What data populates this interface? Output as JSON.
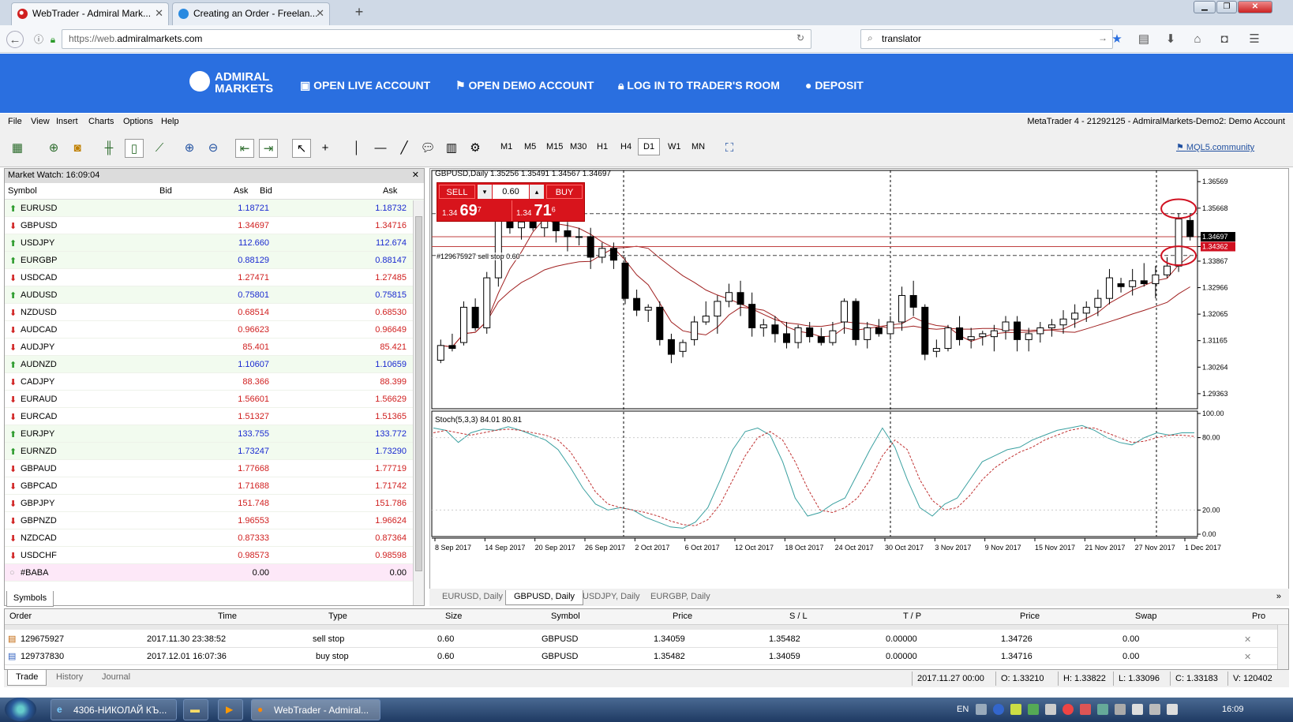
{
  "browser": {
    "tabs": [
      {
        "title": "WebTrader - Admiral Mark..."
      },
      {
        "title": "Creating an Order - Freelan..."
      }
    ],
    "url_prefix": "https://web.",
    "url_host": "admiralmarkets.com",
    "search_value": "translator"
  },
  "site": {
    "logo_line1": "ADMIRAL",
    "logo_line2": "MARKETS",
    "nav": [
      "OPEN LIVE ACCOUNT",
      "OPEN DEMO ACCOUNT",
      "LOG IN TO TRADER'S ROOM",
      "DEPOSIT"
    ]
  },
  "menu": {
    "items": [
      "File",
      "View",
      "Insert",
      "Charts",
      "Options",
      "Help"
    ],
    "account_title": "MetaTrader 4 - 21292125 - AdmiralMarkets-Demo2: Demo Account"
  },
  "toolbar": {
    "timeframes": [
      "M1",
      "M5",
      "M15",
      "M30",
      "H1",
      "H4",
      "D1",
      "W1",
      "MN"
    ],
    "active_timeframe": "D1",
    "community_link": "MQL5.community"
  },
  "market_watch": {
    "title": "Market Watch: 16:09:04",
    "columns": [
      "Symbol",
      "Bid",
      "Ask",
      "Bid",
      "Ask"
    ],
    "rows": [
      {
        "symbol": "EURUSD",
        "dir": "up",
        "bid": "1.18721",
        "ask": "1.18732"
      },
      {
        "symbol": "GBPUSD",
        "dir": "down",
        "bid": "1.34697",
        "ask": "1.34716"
      },
      {
        "symbol": "USDJPY",
        "dir": "up",
        "bid": "112.660",
        "ask": "112.674"
      },
      {
        "symbol": "EURGBP",
        "dir": "up",
        "bid": "0.88129",
        "ask": "0.88147"
      },
      {
        "symbol": "USDCAD",
        "dir": "down",
        "bid": "1.27471",
        "ask": "1.27485"
      },
      {
        "symbol": "AUDUSD",
        "dir": "up",
        "bid": "0.75801",
        "ask": "0.75815"
      },
      {
        "symbol": "NZDUSD",
        "dir": "down",
        "bid": "0.68514",
        "ask": "0.68530"
      },
      {
        "symbol": "AUDCAD",
        "dir": "down",
        "bid": "0.96623",
        "ask": "0.96649"
      },
      {
        "symbol": "AUDJPY",
        "dir": "down",
        "bid": "85.401",
        "ask": "85.421"
      },
      {
        "symbol": "AUDNZD",
        "dir": "up",
        "bid": "1.10607",
        "ask": "1.10659"
      },
      {
        "symbol": "CADJPY",
        "dir": "down",
        "bid": "88.366",
        "ask": "88.399"
      },
      {
        "symbol": "EURAUD",
        "dir": "down",
        "bid": "1.56601",
        "ask": "1.56629"
      },
      {
        "symbol": "EURCAD",
        "dir": "down",
        "bid": "1.51327",
        "ask": "1.51365"
      },
      {
        "symbol": "EURJPY",
        "dir": "up",
        "bid": "133.755",
        "ask": "133.772"
      },
      {
        "symbol": "EURNZD",
        "dir": "up",
        "bid": "1.73247",
        "ask": "1.73290"
      },
      {
        "symbol": "GBPAUD",
        "dir": "down",
        "bid": "1.77668",
        "ask": "1.77719"
      },
      {
        "symbol": "GBPCAD",
        "dir": "down",
        "bid": "1.71688",
        "ask": "1.71742"
      },
      {
        "symbol": "GBPJPY",
        "dir": "down",
        "bid": "151.748",
        "ask": "151.786"
      },
      {
        "symbol": "GBPNZD",
        "dir": "down",
        "bid": "1.96553",
        "ask": "1.96624"
      },
      {
        "symbol": "NZDCAD",
        "dir": "down",
        "bid": "0.87333",
        "ask": "0.87364"
      },
      {
        "symbol": "USDCHF",
        "dir": "down",
        "bid": "0.98573",
        "ask": "0.98598"
      },
      {
        "symbol": "#BABA",
        "dir": "none",
        "bid": "0.00",
        "ask": "0.00"
      }
    ],
    "tab": "Symbols"
  },
  "chart": {
    "header": "GBPUSD,Daily  1.35256 1.35491 1.34567 1.34697",
    "sell_label": "SELL",
    "buy_label": "BUY",
    "lot": "0.60",
    "sell_price_prefix": "1.34",
    "sell_price_big": "69",
    "sell_price_sup": "7",
    "buy_price_prefix": "1.34",
    "buy_price_big": "71",
    "buy_price_sup": "6",
    "order_label": "#129675927 sell stop 0.60",
    "indicator_label": "Stoch(5,3,3) 84.01 80.81",
    "price_scale": [
      "1.36569",
      "1.35668",
      "1.34697",
      "1.34362",
      "1.33867",
      "1.32966",
      "1.32065",
      "1.31165",
      "1.30264",
      "1.29363"
    ],
    "stoch_scale": [
      "100.00",
      "80.00",
      "20.00",
      "0.00"
    ],
    "dates": [
      "8 Sep 2017",
      "14 Sep 2017",
      "20 Sep 2017",
      "26 Sep 2017",
      "2 Oct 2017",
      "6 Oct 2017",
      "12 Oct 2017",
      "18 Oct 2017",
      "24 Oct 2017",
      "30 Oct 2017",
      "3 Nov 2017",
      "9 Nov 2017",
      "15 Nov 2017",
      "21 Nov 2017",
      "27 Nov 2017",
      "1 Dec 2017"
    ],
    "tabs": [
      "EURUSD, Daily",
      "GBPUSD, Daily",
      "USDJPY, Daily",
      "EURGBP, Daily"
    ],
    "active_tab": "GBPUSD, Daily",
    "colors": {
      "bid_line": "#000000",
      "ask_line": "#d00000",
      "ma": "#a02020",
      "stoch_main": "#3aa0a0",
      "stoch_signal": "#c03030",
      "circle": "#d01020"
    }
  },
  "chart_data": {
    "type": "candlestick",
    "symbol": "GBPUSD",
    "timeframe": "Daily",
    "ylim": [
      1.2885,
      1.3695
    ],
    "candles": [
      [
        1.305,
        1.312,
        1.304,
        1.31
      ],
      [
        1.31,
        1.314,
        1.308,
        1.309
      ],
      [
        1.311,
        1.325,
        1.31,
        1.323
      ],
      [
        1.323,
        1.326,
        1.315,
        1.316
      ],
      [
        1.316,
        1.335,
        1.314,
        1.333
      ],
      [
        1.333,
        1.362,
        1.33,
        1.358
      ],
      [
        1.358,
        1.365,
        1.348,
        1.35
      ],
      [
        1.35,
        1.356,
        1.346,
        1.352
      ],
      [
        1.352,
        1.36,
        1.349,
        1.35
      ],
      [
        1.35,
        1.358,
        1.347,
        1.356
      ],
      [
        1.356,
        1.36,
        1.345,
        1.349
      ],
      [
        1.349,
        1.352,
        1.342,
        1.347
      ],
      [
        1.347,
        1.35,
        1.344,
        1.347
      ],
      [
        1.347,
        1.35,
        1.336,
        1.34
      ],
      [
        1.34,
        1.345,
        1.338,
        1.343
      ],
      [
        1.343,
        1.345,
        1.336,
        1.339
      ],
      [
        1.338,
        1.34,
        1.324,
        1.326
      ],
      [
        1.326,
        1.329,
        1.32,
        1.322
      ],
      [
        1.322,
        1.324,
        1.318,
        1.323
      ],
      [
        1.323,
        1.325,
        1.31,
        1.312
      ],
      [
        1.312,
        1.314,
        1.304,
        1.307
      ],
      [
        1.308,
        1.312,
        1.306,
        1.311
      ],
      [
        1.312,
        1.32,
        1.31,
        1.318
      ],
      [
        1.318,
        1.325,
        1.317,
        1.32
      ],
      [
        1.32,
        1.327,
        1.314,
        1.325
      ],
      [
        1.325,
        1.331,
        1.323,
        1.328
      ],
      [
        1.328,
        1.332,
        1.32,
        1.324
      ],
      [
        1.324,
        1.328,
        1.313,
        1.316
      ],
      [
        1.316,
        1.319,
        1.313,
        1.317
      ],
      [
        1.317,
        1.32,
        1.311,
        1.314
      ],
      [
        1.314,
        1.318,
        1.309,
        1.311
      ],
      [
        1.311,
        1.317,
        1.309,
        1.316
      ],
      [
        1.316,
        1.318,
        1.311,
        1.313
      ],
      [
        1.313,
        1.316,
        1.31,
        1.311
      ],
      [
        1.311,
        1.318,
        1.31,
        1.315
      ],
      [
        1.318,
        1.326,
        1.314,
        1.325
      ],
      [
        1.325,
        1.326,
        1.31,
        1.312
      ],
      [
        1.312,
        1.318,
        1.309,
        1.316
      ],
      [
        1.316,
        1.319,
        1.313,
        1.314
      ],
      [
        1.314,
        1.32,
        1.312,
        1.318
      ],
      [
        1.318,
        1.33,
        1.315,
        1.327
      ],
      [
        1.327,
        1.332,
        1.32,
        1.323
      ],
      [
        1.323,
        1.324,
        1.305,
        1.307
      ],
      [
        1.308,
        1.312,
        1.306,
        1.309
      ],
      [
        1.309,
        1.317,
        1.308,
        1.316
      ],
      [
        1.316,
        1.32,
        1.31,
        1.312
      ],
      [
        1.312,
        1.316,
        1.309,
        1.313
      ],
      [
        1.313,
        1.315,
        1.31,
        1.314
      ],
      [
        1.313,
        1.317,
        1.308,
        1.315
      ],
      [
        1.315,
        1.32,
        1.312,
        1.318
      ],
      [
        1.318,
        1.32,
        1.308,
        1.312
      ],
      [
        1.312,
        1.316,
        1.308,
        1.314
      ],
      [
        1.314,
        1.318,
        1.311,
        1.316
      ],
      [
        1.316,
        1.319,
        1.313,
        1.317
      ],
      [
        1.317,
        1.322,
        1.314,
        1.319
      ],
      [
        1.319,
        1.324,
        1.316,
        1.321
      ],
      [
        1.321,
        1.325,
        1.318,
        1.323
      ],
      [
        1.323,
        1.329,
        1.32,
        1.326
      ],
      [
        1.326,
        1.336,
        1.324,
        1.333
      ],
      [
        1.331,
        1.333,
        1.328,
        1.33
      ],
      [
        1.33,
        1.336,
        1.327,
        1.332
      ],
      [
        1.332,
        1.338,
        1.33,
        1.331
      ],
      [
        1.331,
        1.337,
        1.326,
        1.334
      ],
      [
        1.334,
        1.34,
        1.333,
        1.337
      ],
      [
        1.337,
        1.355,
        1.335,
        1.353
      ],
      [
        1.3525,
        1.3549,
        1.3457,
        1.347
      ]
    ],
    "stoch_main": [
      88,
      86,
      76,
      84,
      87,
      86,
      89,
      86,
      82,
      78,
      70,
      55,
      38,
      25,
      20,
      22,
      20,
      14,
      10,
      6,
      5,
      10,
      22,
      45,
      70,
      85,
      88,
      82,
      60,
      30,
      15,
      18,
      25,
      30,
      50,
      70,
      88,
      72,
      45,
      22,
      15,
      25,
      30,
      45,
      60,
      65,
      70,
      72,
      78,
      82,
      86,
      88,
      90,
      86,
      80,
      76,
      74,
      80,
      84,
      82,
      84,
      84
    ],
    "stoch_signal": [
      84,
      86,
      84,
      82,
      84,
      86,
      87,
      86,
      84,
      82,
      78,
      68,
      52,
      35,
      25,
      22,
      20,
      18,
      15,
      11,
      8,
      7,
      12,
      25,
      45,
      65,
      80,
      85,
      78,
      60,
      38,
      20,
      18,
      22,
      30,
      45,
      65,
      78,
      70,
      45,
      28,
      20,
      22,
      32,
      45,
      55,
      62,
      68,
      72,
      78,
      82,
      86,
      88,
      88,
      84,
      80,
      76,
      77,
      80,
      82,
      82,
      81
    ]
  },
  "orders": {
    "columns": [
      "Order",
      "Time",
      "Type",
      "Size",
      "Symbol",
      "Price",
      "S / L",
      "T / P",
      "Price",
      "Swap",
      "Pro"
    ],
    "rows": [
      [
        "129675927",
        "2017.11.30 23:38:52",
        "sell stop",
        "0.60",
        "GBPUSD",
        "1.34059",
        "1.35482",
        "0.00000",
        "1.34726",
        "0.00"
      ],
      [
        "129737830",
        "2017.12.01 16:07:36",
        "buy stop",
        "0.60",
        "GBPUSD",
        "1.35482",
        "1.34059",
        "0.00000",
        "1.34716",
        "0.00"
      ]
    ]
  },
  "bottom": {
    "tabs": [
      "Trade",
      "History",
      "Journal"
    ],
    "status": [
      "2017.11.27 00:00",
      "O: 1.33210",
      "H: 1.33822",
      "L: 1.33096",
      "C: 1.33183",
      "V: 120402"
    ]
  },
  "taskbar": {
    "items": [
      "4306-НИКОЛАЙ КЪ...",
      "WebTrader - Admiral..."
    ],
    "lang": "EN",
    "clock": "16:09"
  }
}
